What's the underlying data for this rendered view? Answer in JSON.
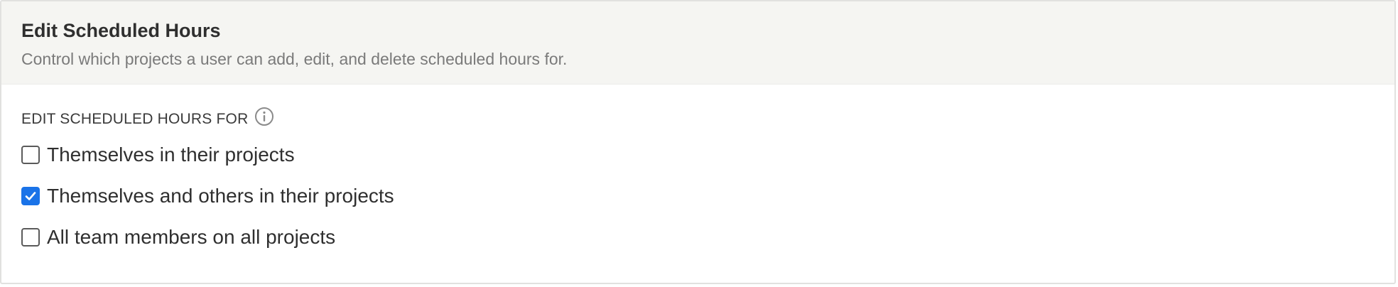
{
  "panel": {
    "title": "Edit Scheduled Hours",
    "subtitle": "Control which projects a user can add, edit, and delete scheduled hours for."
  },
  "section": {
    "label": "EDIT SCHEDULED HOURS FOR",
    "info_icon": "info-icon"
  },
  "options": [
    {
      "label": "Themselves in their projects",
      "checked": false
    },
    {
      "label": "Themselves and others in their projects",
      "checked": true
    },
    {
      "label": "All team members on all projects",
      "checked": false
    }
  ],
  "colors": {
    "header_background": "#f5f5f2",
    "checkbox_checked": "#1a73e8",
    "text_primary": "#2f2f2f",
    "text_secondary": "#7a7a7a"
  }
}
